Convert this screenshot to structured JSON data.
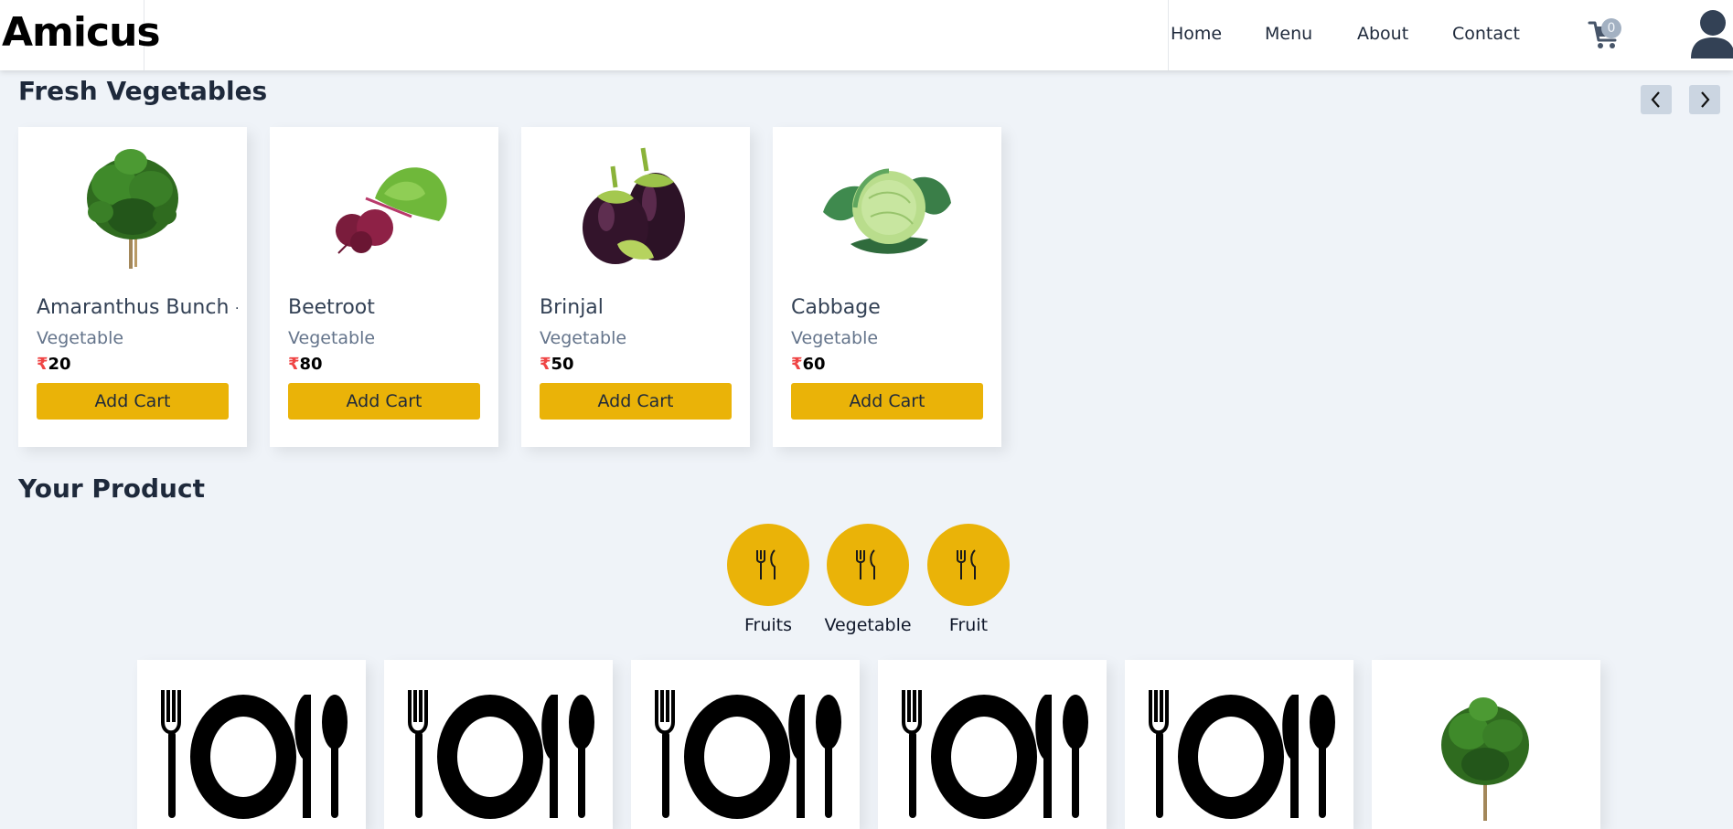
{
  "header": {
    "logo": "Amicus",
    "nav": [
      "Home",
      "Menu",
      "About",
      "Contact"
    ],
    "cart_count": "0",
    "icons": {
      "cart": "cart-icon",
      "avatar": "user-avatar-icon"
    }
  },
  "fresh": {
    "title": "Fresh Vegetables",
    "products": [
      {
        "name": "Amaranthus Bunch -",
        "category": "Vegetable",
        "currency": "₹",
        "price": "20",
        "button": "Add Cart"
      },
      {
        "name": "Beetroot",
        "category": "Vegetable",
        "currency": "₹",
        "price": "80",
        "button": "Add Cart"
      },
      {
        "name": "Brinjal",
        "category": "Vegetable",
        "currency": "₹",
        "price": "50",
        "button": "Add Cart"
      },
      {
        "name": "Cabbage",
        "category": "Vegetable",
        "currency": "₹",
        "price": "60",
        "button": "Add Cart"
      }
    ]
  },
  "your_product": {
    "title": "Your Product",
    "categories": [
      "Fruits",
      "Vegetable",
      "Fruit"
    ]
  },
  "colors": {
    "accent": "#eab308",
    "price_symbol": "#ef4444",
    "background": "#eff3f8"
  }
}
